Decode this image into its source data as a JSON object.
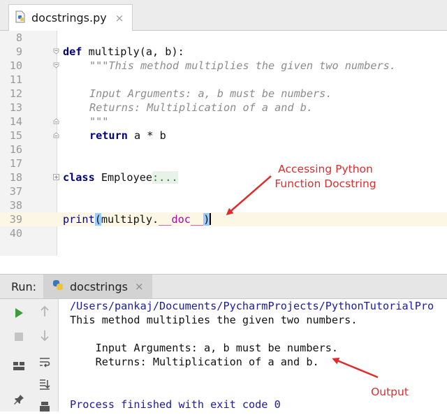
{
  "editor_tab": {
    "label": "docstrings.py",
    "close": "×"
  },
  "editor": {
    "lines": [
      {
        "num": "8"
      },
      {
        "num": "9"
      },
      {
        "num": "10"
      },
      {
        "num": "11"
      },
      {
        "num": "12"
      },
      {
        "num": "13"
      },
      {
        "num": "14"
      },
      {
        "num": "15"
      },
      {
        "num": "16"
      },
      {
        "num": "17"
      },
      {
        "num": "18"
      },
      {
        "num": "37"
      },
      {
        "num": "38"
      },
      {
        "num": "39"
      },
      {
        "num": "40"
      }
    ],
    "code": {
      "l9_kw": "def",
      "l9_rest": " multiply(a, b):",
      "l10": "\"\"\"This method multiplies the given two numbers.",
      "l12": "Input Arguments: a, b must be numbers.",
      "l13": "Returns: Multiplication of a and b.",
      "l14": "\"\"\"",
      "l15_kw": "return",
      "l15_rest": " a * b",
      "l18_kw": "class",
      "l18_name": " Employee",
      "l18_fold": ":...",
      "l39_print": "print",
      "l39_open": "(",
      "l39_mid": "multiply.",
      "l39_dunder": "__doc__",
      "l39_close": ")"
    }
  },
  "annotations": {
    "docstring_line1": "Accessing Python",
    "docstring_line2": "Function Docstring",
    "output": "Output"
  },
  "run": {
    "title": "Run:",
    "tab_label": "docstrings",
    "tab_close": "×"
  },
  "console": {
    "lines": [
      "/Users/pankaj/Documents/PycharmProjects/PythonTutorialPro",
      "This method multiplies the given two numbers.",
      "",
      "    Input Arguments: a, b must be numbers.",
      "    Returns: Multiplication of a and b.",
      "",
      "Process finished with exit code 0"
    ]
  },
  "colors": {
    "keyword": "#000080",
    "docstring": "#8c8c8c",
    "dunder": "#b200b2",
    "annotation": "#e02b2b",
    "run_icon": "#3c9e3c"
  }
}
